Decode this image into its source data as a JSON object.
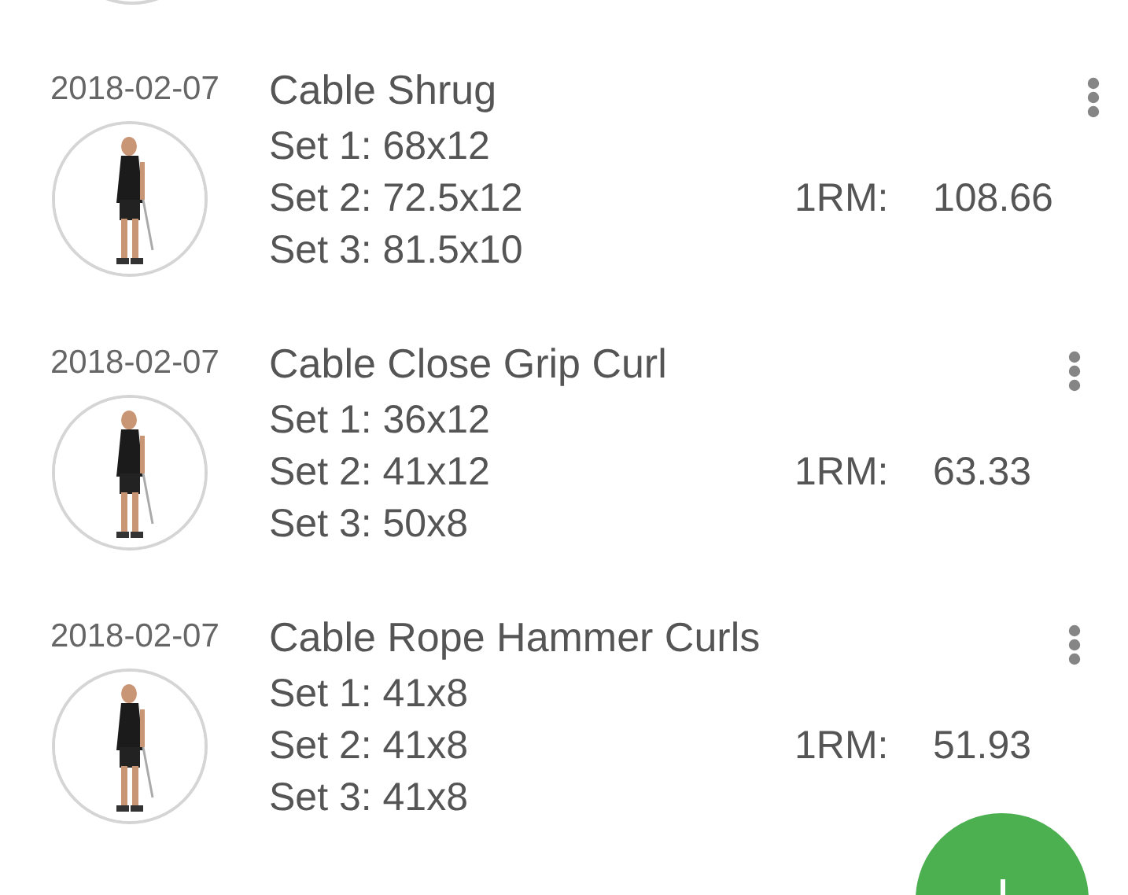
{
  "entries": [
    {
      "date": "2018-02-07",
      "title": "Cable Shrug",
      "sets": [
        "Set 1: 68x12",
        "Set 2: 72.5x12",
        "Set 3: 81.5x10"
      ],
      "one_rm_label": "1RM:",
      "one_rm": "108.66"
    },
    {
      "date": "2018-02-07",
      "title": "Cable Close Grip Curl",
      "sets": [
        "Set 1: 36x12",
        "Set 2: 41x12",
        "Set 3: 50x8"
      ],
      "one_rm_label": "1RM:",
      "one_rm": "63.33"
    },
    {
      "date": "2018-02-07",
      "title": "Cable Rope Hammer Curls",
      "sets": [
        "Set 1: 41x8",
        "Set 2: 41x8",
        "Set 3: 41x8"
      ],
      "one_rm_label": "1RM:",
      "one_rm": "51.93"
    }
  ]
}
